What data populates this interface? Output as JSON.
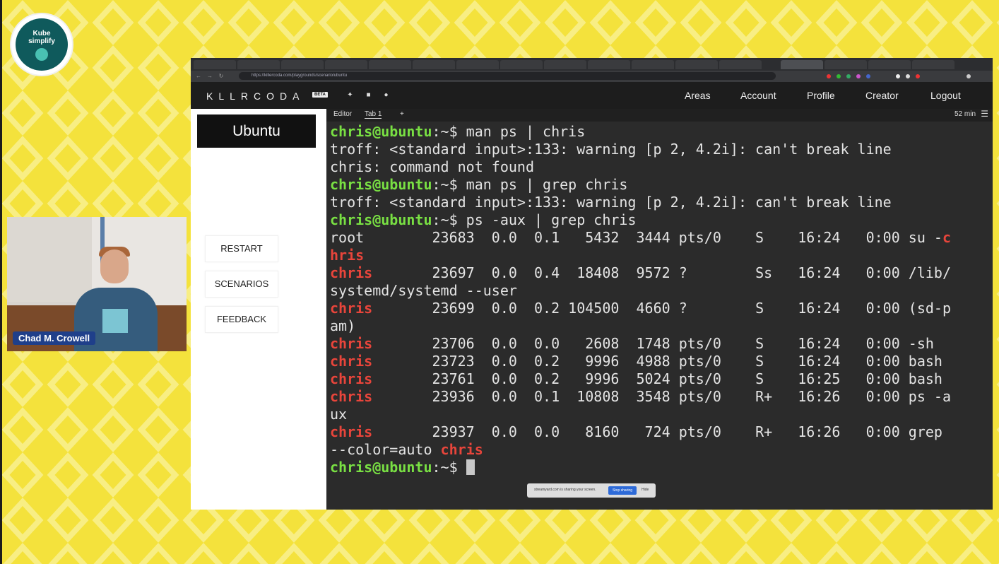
{
  "colors": {
    "background": "#f4e23c",
    "terminal_bg": "#2b2b2b",
    "user_green": "#79e043",
    "highlight_red": "#e8453b",
    "header_bg": "#1d1d1d"
  },
  "logo": {
    "line1": "Kube",
    "line2": "simplify"
  },
  "webcam": {
    "name": "Chad M. Crowell"
  },
  "browser": {
    "url": "https://killercoda.com/playgrounds/scenario/ubuntu"
  },
  "killercoda": {
    "brand": "KLLRCODA",
    "beta": "BETA",
    "social_icons": [
      "twitter-icon",
      "linkedin-icon",
      "github-icon"
    ],
    "menu": [
      "Areas",
      "Account",
      "Profile",
      "Creator",
      "Logout"
    ]
  },
  "sidebar": {
    "title": "Ubuntu",
    "buttons": [
      "RESTART",
      "SCENARIOS",
      "FEEDBACK"
    ]
  },
  "terminal": {
    "tabs": [
      "Editor",
      "Tab 1",
      "+"
    ],
    "time_remaining": "52 min",
    "lines": [
      [
        {
          "t": "chris@ubuntu",
          "c": "u"
        },
        {
          "t": ":~$ man ps | chris",
          "c": ""
        }
      ],
      [
        {
          "t": "troff: <standard input>:133: warning [p 2, 4.2i]: can't break line",
          "c": ""
        }
      ],
      [
        {
          "t": "chris: command not found",
          "c": ""
        }
      ],
      [
        {
          "t": "chris@ubuntu",
          "c": "u"
        },
        {
          "t": ":~$ man ps | grep chris",
          "c": ""
        }
      ],
      [
        {
          "t": "troff: <standard input>:133: warning [p 2, 4.2i]: can't break line",
          "c": ""
        }
      ],
      [
        {
          "t": "chris@ubuntu",
          "c": "u"
        },
        {
          "t": ":~$ ps -aux | grep chris",
          "c": ""
        }
      ],
      [
        {
          "t": "root        23683  0.0  0.1   5432  3444 pts/0    S    16:24   0:00 su -",
          "c": ""
        },
        {
          "t": "c",
          "c": "r"
        }
      ],
      [
        {
          "t": "hris",
          "c": "r"
        }
      ],
      [
        {
          "t": "chris",
          "c": "r"
        },
        {
          "t": "       23697  0.0  0.4  18408  9572 ?        Ss   16:24   0:00 /lib/",
          "c": ""
        }
      ],
      [
        {
          "t": "systemd/systemd --user",
          "c": ""
        }
      ],
      [
        {
          "t": "chris",
          "c": "r"
        },
        {
          "t": "       23699  0.0  0.2 104500  4660 ?        S    16:24   0:00 (sd-p",
          "c": ""
        }
      ],
      [
        {
          "t": "am)",
          "c": ""
        }
      ],
      [
        {
          "t": "chris",
          "c": "r"
        },
        {
          "t": "       23706  0.0  0.0   2608  1748 pts/0    S    16:24   0:00 -sh",
          "c": ""
        }
      ],
      [
        {
          "t": "chris",
          "c": "r"
        },
        {
          "t": "       23723  0.0  0.2   9996  4988 pts/0    S    16:24   0:00 bash",
          "c": ""
        }
      ],
      [
        {
          "t": "chris",
          "c": "r"
        },
        {
          "t": "       23761  0.0  0.2   9996  5024 pts/0    S    16:25   0:00 bash",
          "c": ""
        }
      ],
      [
        {
          "t": "chris",
          "c": "r"
        },
        {
          "t": "       23936  0.0  0.1  10808  3548 pts/0    R+   16:26   0:00 ps -a",
          "c": ""
        }
      ],
      [
        {
          "t": "ux",
          "c": ""
        }
      ],
      [
        {
          "t": "chris",
          "c": "r"
        },
        {
          "t": "       23937  0.0  0.0   8160   724 pts/0    R+   16:26   0:00 grep",
          "c": ""
        }
      ],
      [
        {
          "t": "--color=auto ",
          "c": ""
        },
        {
          "t": "chris",
          "c": "r"
        }
      ],
      [
        {
          "t": "chris@ubuntu",
          "c": "u"
        },
        {
          "t": ":~$ ",
          "c": ""
        },
        {
          "t": "",
          "c": "cursor"
        }
      ]
    ]
  },
  "screen_share": {
    "text": "streamyard.com is sharing your screen.",
    "stop": "Stop sharing",
    "hide": "Hide"
  }
}
